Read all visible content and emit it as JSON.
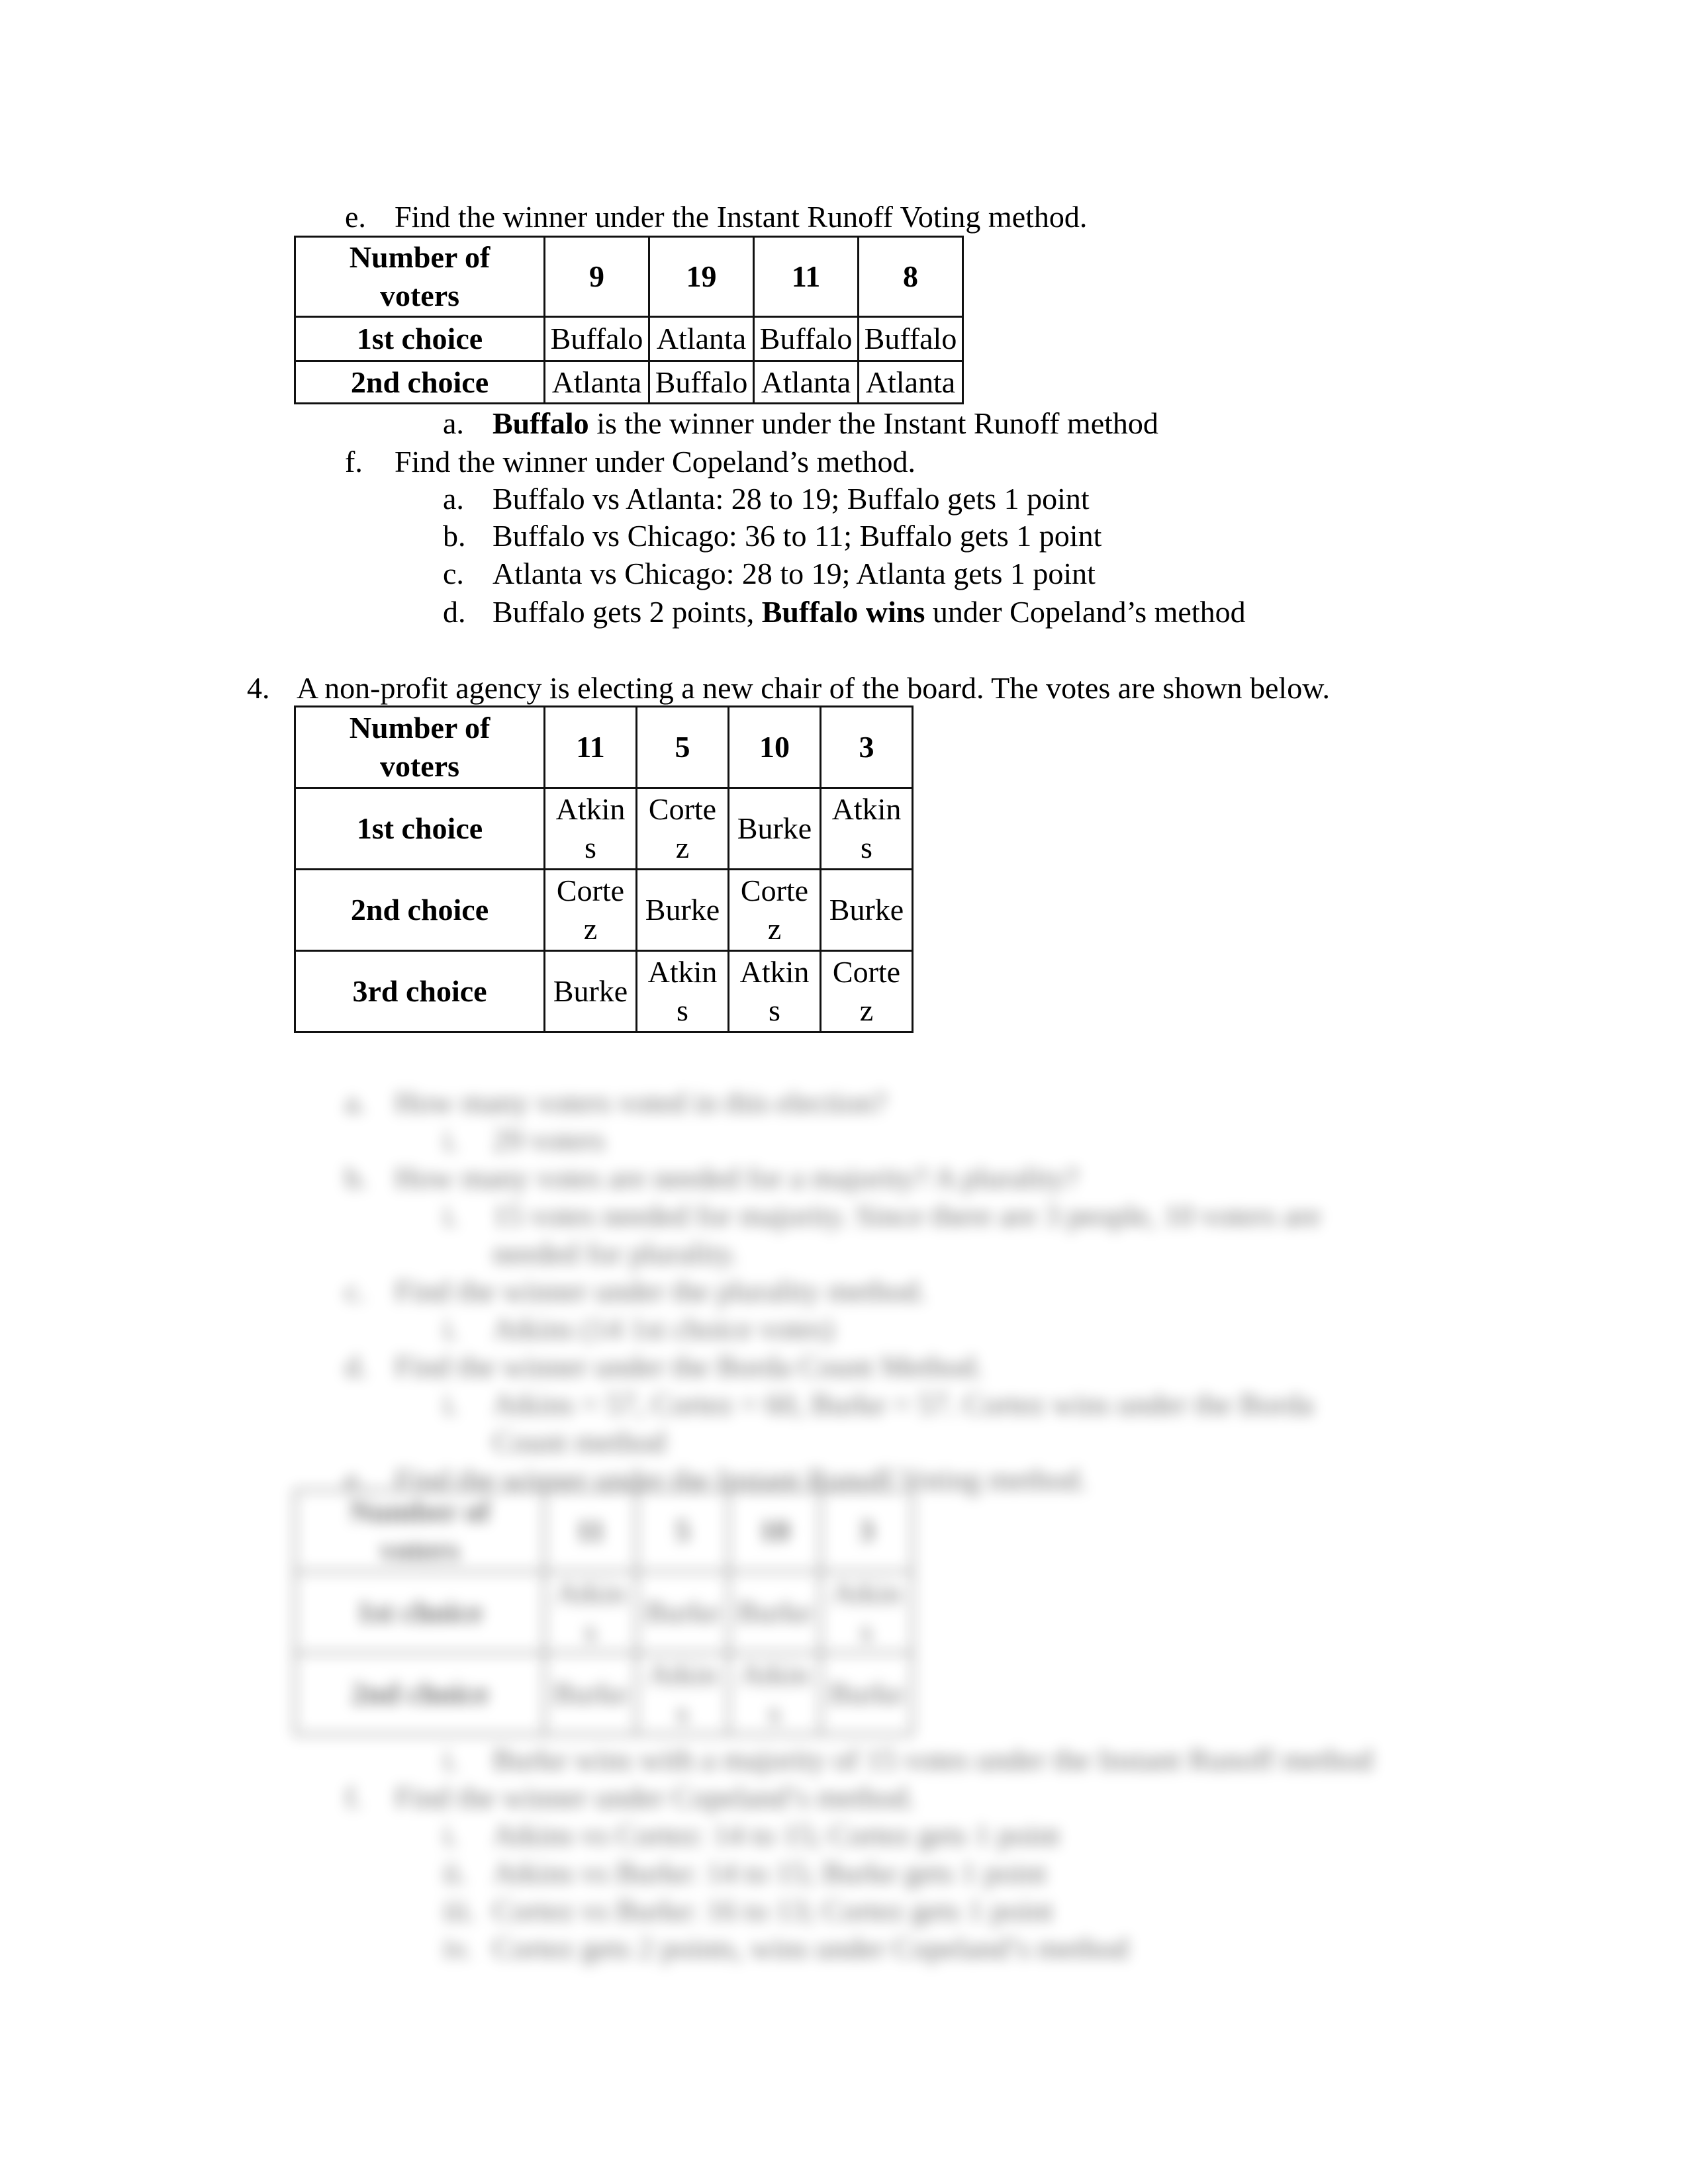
{
  "section_e": {
    "marker": "e.",
    "prompt": "Find the winner under the Instant Runoff Voting method.",
    "table": {
      "header_label": "Number of voters",
      "voter_counts": [
        "9",
        "19",
        "11",
        "8"
      ],
      "rows": [
        {
          "label": "1st choice",
          "cells": [
            "Buffalo",
            "Atlanta",
            "Buffalo",
            "Buffalo"
          ]
        },
        {
          "label": "2nd choice",
          "cells": [
            "Atlanta",
            "Buffalo",
            "Atlanta",
            "Atlanta"
          ]
        }
      ]
    },
    "answer": {
      "marker": "a.",
      "bold": "Buffalo",
      "rest": " is the winner under the Instant Runoff method"
    }
  },
  "section_f": {
    "marker": "f.",
    "prompt": "Find the winner under Copeland’s method.",
    "items": [
      {
        "marker": "a.",
        "text": "Buffalo vs Atlanta: 28 to 19; Buffalo gets 1 point"
      },
      {
        "marker": "b.",
        "text": "Buffalo vs Chicago: 36 to 11; Buffalo gets 1 point"
      },
      {
        "marker": "c.",
        "text": "Atlanta vs Chicago: 28 to 19; Atlanta gets 1 point"
      },
      {
        "marker": "d.",
        "pre": "Buffalo gets 2 points, ",
        "bold": "Buffalo wins",
        "post": " under Copeland’s method"
      }
    ]
  },
  "question4": {
    "marker": "4.",
    "prompt": "A non-profit agency is electing a new chair of the board.  The votes are shown below.",
    "table": {
      "header_label": "Number of voters",
      "voter_counts": [
        "11",
        "5",
        "10",
        "3"
      ],
      "rows": [
        {
          "label": "1st choice",
          "cells": [
            "Atkins",
            "Cortez",
            "Burke",
            "Atkins"
          ]
        },
        {
          "label": "2nd choice",
          "cells": [
            "Cortez",
            "Burke",
            "Cortez",
            "Burke"
          ]
        },
        {
          "label": "3rd choice",
          "cells": [
            "Burke",
            "Atkins",
            "Atkins",
            "Cortez"
          ]
        }
      ]
    }
  },
  "blurred_preview": {
    "lines": [
      {
        "marker": "a.",
        "text": "How many voters voted in this election?"
      },
      {
        "marker": "i.",
        "text": "29 voters",
        "sub": true
      },
      {
        "marker": "b.",
        "text": "How many votes are needed for a majority?  A plurality?"
      },
      {
        "marker": "i.",
        "text": "15 votes needed for majority. Since there are 3 people, 10 voters are",
        "sub": true
      },
      {
        "marker": "",
        "text": "needed for plurality.",
        "sub": true
      },
      {
        "marker": "c.",
        "text": "Find the winner under the plurality method."
      },
      {
        "marker": "i.",
        "text": "Atkins (14 1st choice votes)",
        "sub": true
      },
      {
        "marker": "d.",
        "text": "Find the winner under the Borda Count Method."
      },
      {
        "marker": "i.",
        "text": "Atkins = 57, Cortez = 60, Burke = 57. Cortez wins under the Borda",
        "sub": true
      },
      {
        "marker": "",
        "text": "Count method",
        "sub": true
      },
      {
        "marker": "e.",
        "text": "Find the winner under the Instant Runoff Voting method."
      }
    ],
    "table": {
      "header_label": "Number of voters",
      "voter_counts": [
        "11",
        "5",
        "10",
        "3"
      ],
      "rows": [
        {
          "label": "1st choice",
          "cells": [
            "Atkins",
            "Burke",
            "Burke",
            "Atkins"
          ]
        },
        {
          "label": "2nd choice",
          "cells": [
            "Burke",
            "Atkins",
            "Atkins",
            "Burke"
          ]
        }
      ]
    },
    "after_lines": [
      {
        "marker": "i.",
        "text": "Burke wins with a majority of 15 votes under the Instant Runoff method",
        "sub": true
      },
      {
        "marker": "f.",
        "text": "Find the winner under Copeland’s method."
      },
      {
        "marker": "i.",
        "text": "Atkins vs Cortez: 14 to 15; Cortez gets 1 point",
        "sub": true
      },
      {
        "marker": "ii.",
        "text": "Atkins vs Burke: 14 to 15; Burke gets 1 point",
        "sub": true
      },
      {
        "marker": "iii.",
        "text": "Cortez vs Burke: 16 to 13; Cortez gets 1 point",
        "sub": true
      },
      {
        "marker": "iv.",
        "text": "Cortez gets 2 points, wins under Copeland’s method",
        "sub": true
      }
    ]
  }
}
